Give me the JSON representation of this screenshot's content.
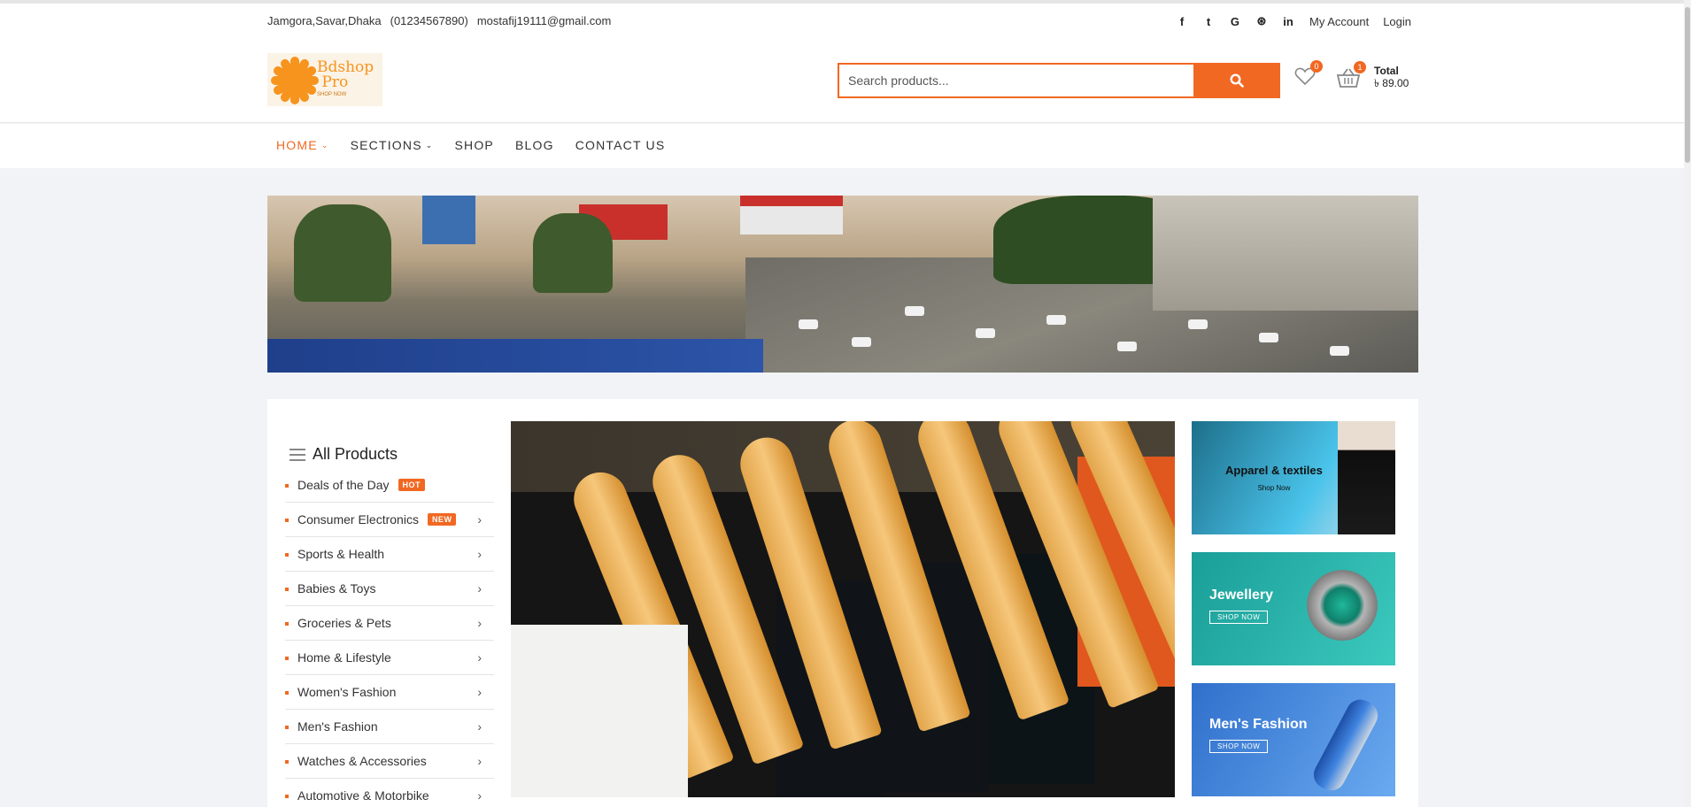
{
  "topbar": {
    "address": "Jamgora,Savar,Dhaka",
    "phone": "(01234567890)",
    "email": "mostafij19111@gmail.com",
    "social_icons": [
      "facebook-icon",
      "twitter-icon",
      "google-plus-icon",
      "dribbble-icon",
      "linkedin-icon"
    ],
    "social_glyphs": {
      "facebook": "f",
      "twitter": "t",
      "google": "G",
      "dribbble": "⊛",
      "linkedin": "in"
    },
    "my_account": "My Account",
    "login": "Login"
  },
  "header": {
    "logo_line1": "Bdshop",
    "logo_line2": "Pro",
    "logo_tagline": "SHOP NOW",
    "search_placeholder": "Search products...",
    "wishlist_count": "0",
    "cart_count": "1",
    "total_label": "Total",
    "total_value": "৳ 89.00"
  },
  "nav": {
    "items": [
      {
        "label": "HOME",
        "dropdown": true,
        "active": true
      },
      {
        "label": "SECTIONS",
        "dropdown": true,
        "active": false
      },
      {
        "label": "SHOP",
        "dropdown": false,
        "active": false
      },
      {
        "label": "BLOG",
        "dropdown": false,
        "active": false
      },
      {
        "label": "CONTACT US",
        "dropdown": false,
        "active": false
      }
    ],
    "chevron": "⌄"
  },
  "categories": {
    "title": "All Products",
    "arrow": "›",
    "items": [
      {
        "label": "Deals of the Day",
        "tag": "HOT",
        "arrow": false
      },
      {
        "label": "Consumer Electronics",
        "tag": "NEW",
        "arrow": true
      },
      {
        "label": "Sports & Health",
        "tag": "",
        "arrow": true
      },
      {
        "label": "Babies & Toys",
        "tag": "",
        "arrow": true
      },
      {
        "label": "Groceries & Pets",
        "tag": "",
        "arrow": true
      },
      {
        "label": "Home & Lifestyle",
        "tag": "",
        "arrow": true
      },
      {
        "label": "Women's Fashion",
        "tag": "",
        "arrow": true
      },
      {
        "label": "Men's Fashion",
        "tag": "",
        "arrow": true
      },
      {
        "label": "Watches & Accessories",
        "tag": "",
        "arrow": true
      },
      {
        "label": "Automotive & Motorbike",
        "tag": "",
        "arrow": true
      }
    ]
  },
  "promos": {
    "apparel_title": "Apparel & textiles",
    "apparel_link": "Shop Now",
    "jewellery_title": "Jewellery",
    "jewellery_btn": "SHOP NOW",
    "mens_title": "Men's Fashion",
    "mens_btn": "SHOP NOW"
  },
  "colors": {
    "accent": "#f16822",
    "text": "#333333",
    "background": "#f1f3f6"
  }
}
